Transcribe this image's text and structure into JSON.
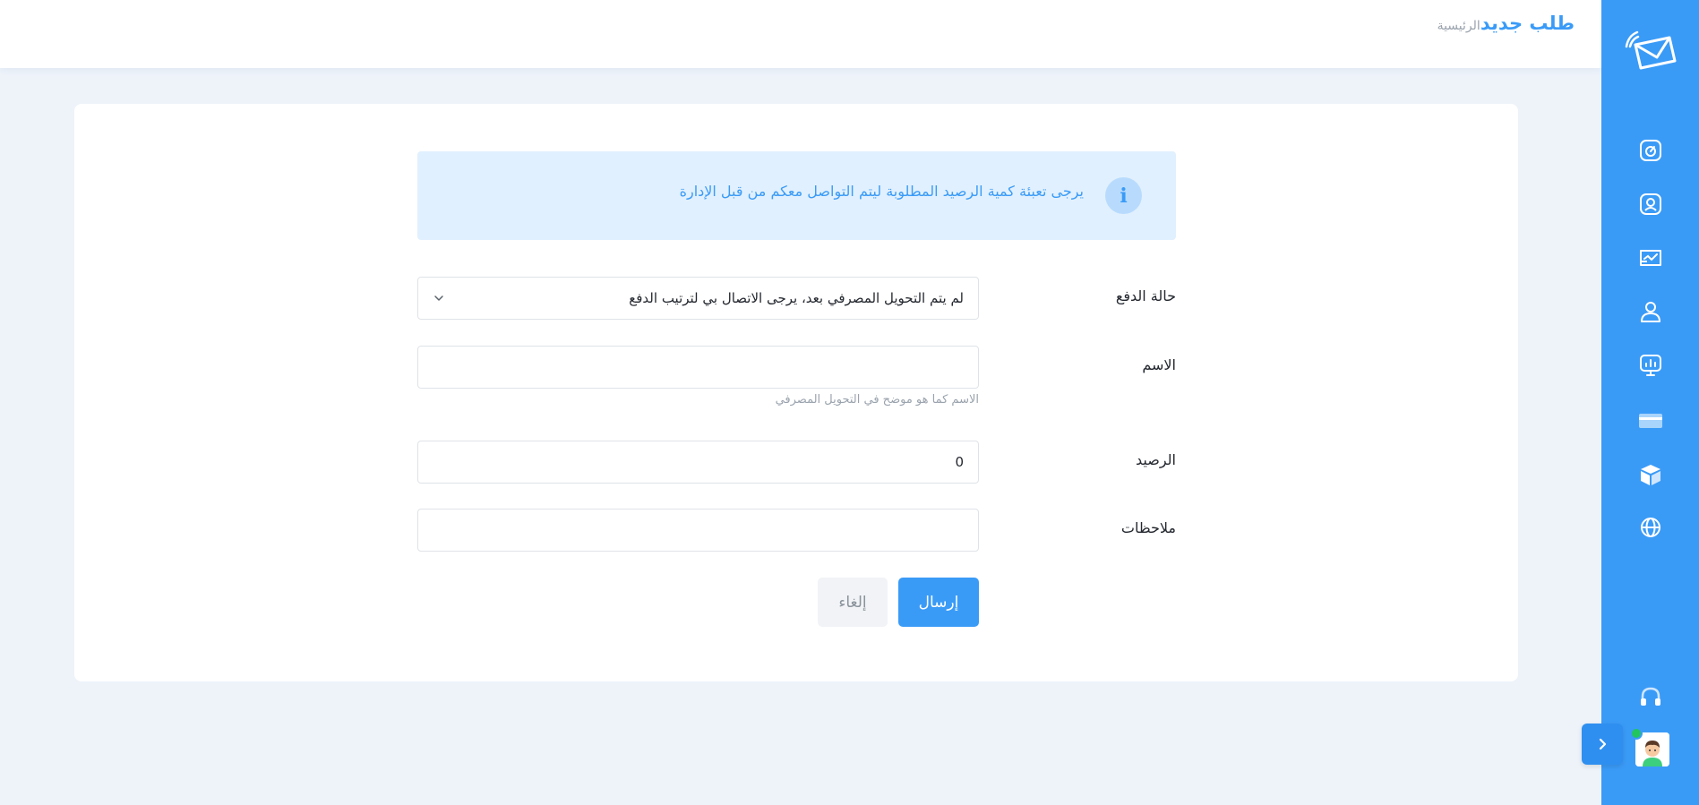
{
  "header": {
    "title": "طلب جديد",
    "breadcrumb": "الرئيسية"
  },
  "alert": {
    "icon": "info-icon",
    "icon_glyph": "i",
    "message": "يرجى تعبئة كمية الرصيد المطلوبة ليتم التواصل معكم من قبل الإدارة"
  },
  "form": {
    "payment_status": {
      "label": "حالة الدفع",
      "selected": "لم يتم التحويل المصرفي بعد، يرجى الاتصال بي لترتيب الدفع"
    },
    "name": {
      "label": "الاسم",
      "value": "",
      "hint": "الاسم كما هو موضح في التحويل المصرفي"
    },
    "balance": {
      "label": "الرصيد",
      "value": "0"
    },
    "notes": {
      "label": "ملاحظات",
      "value": ""
    },
    "submit_label": "إرسال",
    "cancel_label": "إلغاء"
  },
  "sidebar": {
    "items": [
      {
        "icon": "dashboard-gauge-icon"
      },
      {
        "icon": "user-badge-icon"
      },
      {
        "icon": "inbox-chart-icon"
      },
      {
        "icon": "user-icon"
      },
      {
        "icon": "presentation-icon"
      },
      {
        "icon": "credit-card-icon"
      },
      {
        "icon": "package-box-icon"
      },
      {
        "icon": "globe-icon"
      },
      {
        "icon": "headphones-icon"
      }
    ]
  },
  "colors": {
    "accent": "#3a9bf7",
    "background": "#eef3fa",
    "alert_bg": "#e1f0fe",
    "online": "#22c55e"
  }
}
